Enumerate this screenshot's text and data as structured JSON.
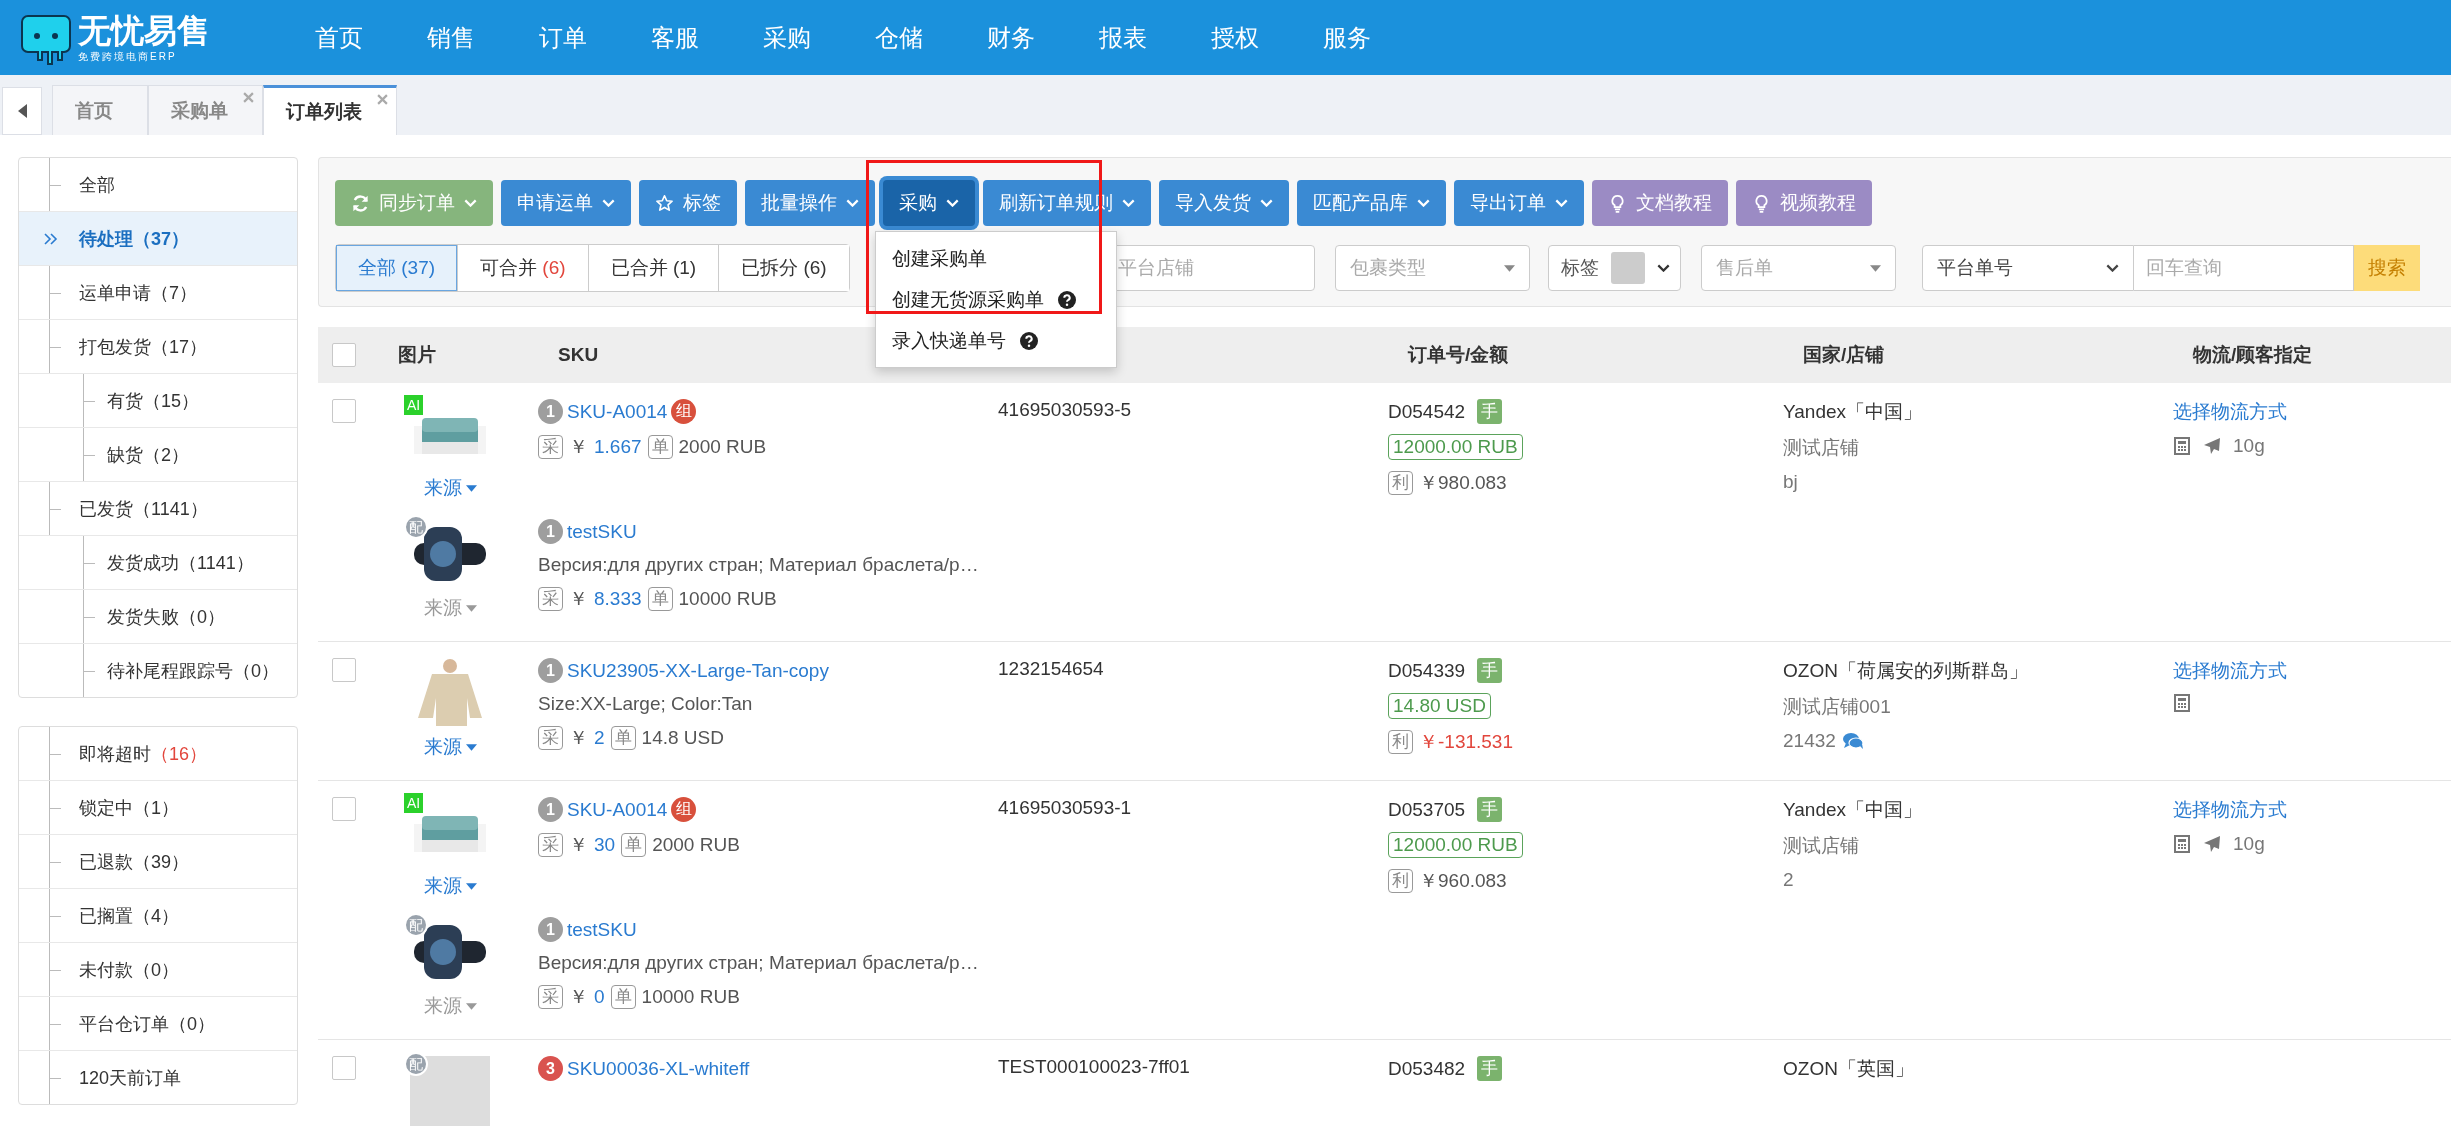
{
  "logo": {
    "title": "无忧易售",
    "subtitle": "免费跨境电商ERP"
  },
  "nav": [
    "首页",
    "销售",
    "订单",
    "客服",
    "采购",
    "仓储",
    "财务",
    "报表",
    "授权",
    "服务"
  ],
  "tabs": [
    {
      "label": "首页",
      "selected": false,
      "closable": false
    },
    {
      "label": "采购单",
      "selected": false,
      "closable": true
    },
    {
      "label": "订单列表",
      "selected": true,
      "closable": true
    }
  ],
  "sidebar": {
    "groups": [
      {
        "items": [
          {
            "label": "全部",
            "selected": false
          },
          {
            "label": "待处理",
            "count": "（37）",
            "alert": false,
            "selected": true
          },
          {
            "label": "运单申请",
            "count": "（7）",
            "alert": false,
            "selected": false
          },
          {
            "label": "打包发货",
            "count": "（17）",
            "alert": false,
            "selected": false,
            "children": [
              {
                "label": "有货",
                "count": "（15）",
                "alert": false,
                "selected": false
              },
              {
                "label": "缺货",
                "count": "（2）",
                "alert": false,
                "selected": false
              }
            ]
          },
          {
            "label": "已发货",
            "count": "（1141）",
            "alert": false,
            "selected": false,
            "children": [
              {
                "label": "发货成功",
                "count": "（1141）",
                "alert": false,
                "selected": false
              },
              {
                "label": "发货失败",
                "count": "（0）",
                "alert": false,
                "selected": false
              },
              {
                "label": "待补尾程跟踪号",
                "count": "（0）",
                "alert": false,
                "selected": false
              }
            ]
          }
        ]
      },
      {
        "items": [
          {
            "label": "即将超时",
            "count": "（16）",
            "alert": true,
            "selected": false
          },
          {
            "label": "锁定中",
            "count": "（1）",
            "alert": false,
            "selected": false
          },
          {
            "label": "已退款",
            "count": "（39）",
            "alert": false,
            "selected": false
          },
          {
            "label": "已搁置",
            "count": "（4）",
            "alert": false,
            "selected": false
          },
          {
            "label": "未付款",
            "count": "（0）",
            "alert": false,
            "selected": false
          },
          {
            "label": "平台仓订单",
            "count": "（0）",
            "alert": false,
            "selected": false
          },
          {
            "label": "120天前订单",
            "selected": false
          }
        ]
      }
    ]
  },
  "toolbar": {
    "buttons": [
      {
        "label": "同步订单",
        "kind": "sync",
        "expanded": false
      },
      {
        "label": "申请运单",
        "kind": "dropdown",
        "expanded": false
      },
      {
        "label": "标签",
        "kind": "tag",
        "expanded": false
      },
      {
        "label": "批量操作",
        "kind": "dropdown",
        "expanded": false
      },
      {
        "label": "采购",
        "kind": "dropdown",
        "expanded": true,
        "menu": [
          {
            "label": "创建采购单",
            "help": false
          },
          {
            "label": "创建无货源采购单",
            "help": true
          },
          {
            "label": "录入快递单号",
            "help": true
          }
        ]
      },
      {
        "label": "刷新订单规则",
        "kind": "dropdown",
        "expanded": false
      },
      {
        "label": "导入发货",
        "kind": "dropdown",
        "expanded": false
      },
      {
        "label": "匹配产品库",
        "kind": "dropdown",
        "expanded": false
      },
      {
        "label": "导出订单",
        "kind": "dropdown",
        "expanded": false
      },
      {
        "label": "文档教程",
        "kind": "tutorial",
        "expanded": false
      },
      {
        "label": "视频教程",
        "kind": "tutorial",
        "expanded": false
      }
    ]
  },
  "filters": {
    "segments": [
      {
        "label": "全部",
        "count": "(37)",
        "alert": false,
        "selected": true
      },
      {
        "label": "可合并",
        "count": "(6)",
        "alert": true,
        "selected": false
      },
      {
        "label": "已合并",
        "count": "(1)",
        "alert": false,
        "selected": false
      },
      {
        "label": "已拆分",
        "count": "(6)",
        "alert": false,
        "selected": false
      }
    ],
    "store": {
      "placeholder": "平台店铺"
    },
    "package_type": {
      "placeholder": "包裹类型"
    },
    "tag": {
      "label": "标签"
    },
    "after_sale": {
      "placeholder": "售后单"
    },
    "search_by": {
      "value": "平台单号"
    },
    "search": {
      "placeholder": "回车查询"
    },
    "search_button": "搜索"
  },
  "table": {
    "select_all_checked": false,
    "columns": [
      {
        "label": "图片"
      },
      {
        "label": "SKU"
      },
      {
        "label": "订单号/金额"
      },
      {
        "label": "国家/店铺"
      },
      {
        "label": "物流/顾客指定"
      }
    ],
    "rows": [
      {
        "checked": false,
        "platform_order": "41695030593-5",
        "order_no": "D054542",
        "mark": "手",
        "amount": "12000.00 RUB",
        "profit_tag": "利",
        "profit": "￥980.083",
        "profit_loss": false,
        "platform": "Yandex「中国」",
        "store": "测试店铺",
        "note": "bj",
        "chat": false,
        "logistics": "选择物流方式",
        "plane": true,
        "weight": "10g",
        "products": [
          {
            "qty": "1",
            "color": "#9e9e9e",
            "sku": "SKU-A0014",
            "combo": "组",
            "image_tag": "AI",
            "kind": "sofa",
            "source": "来源",
            "source_linked": true,
            "cost_tag": "采",
            "currency": "￥",
            "cost": "1.667",
            "price_tag": "单",
            "price": "2000 RUB"
          },
          {
            "qty": "1",
            "color": "#9e9e9e",
            "sku": "testSKU",
            "attrs": "Версия:для других стран; Материал браслета/р…",
            "image_tag": "配",
            "kind": "watch",
            "source": "来源",
            "source_linked": false,
            "cost_tag": "采",
            "currency": "￥",
            "cost": "8.333",
            "price_tag": "单",
            "price": "10000 RUB"
          }
        ]
      },
      {
        "checked": false,
        "platform_order": "1232154654",
        "order_no": "D054339",
        "mark": "手",
        "amount": "14.80 USD",
        "profit_tag": "利",
        "profit": "￥-131.531",
        "profit_loss": true,
        "platform": "OZON「荷属安的列斯群岛」",
        "store": "测试店铺001",
        "note": "21432",
        "chat": true,
        "logistics": "选择物流方式",
        "plane": false,
        "products": [
          {
            "qty": "1",
            "color": "#9e9e9e",
            "sku": "SKU23905-XX-Large-Tan-copy",
            "attrs": "Size:XX-Large; Color:Tan",
            "kind": "sweater",
            "source": "来源",
            "source_linked": true,
            "cost_tag": "采",
            "currency": "￥",
            "cost": "2",
            "price_tag": "单",
            "price": "14.8 USD"
          }
        ]
      },
      {
        "checked": false,
        "platform_order": "41695030593-1",
        "order_no": "D053705",
        "mark": "手",
        "amount": "12000.00 RUB",
        "profit_tag": "利",
        "profit": "￥960.083",
        "profit_loss": false,
        "platform": "Yandex「中国」",
        "store": "测试店铺",
        "note": "2",
        "chat": false,
        "logistics": "选择物流方式",
        "plane": true,
        "weight": "10g",
        "products": [
          {
            "qty": "1",
            "color": "#9e9e9e",
            "sku": "SKU-A0014",
            "combo": "组",
            "image_tag": "AI",
            "kind": "sofa",
            "source": "来源",
            "source_linked": true,
            "cost_tag": "采",
            "currency": "￥",
            "cost": "30",
            "price_tag": "单",
            "price": "2000 RUB"
          },
          {
            "qty": "1",
            "color": "#9e9e9e",
            "sku": "testSKU",
            "attrs": "Версия:для других стран; Материал браслета/р…",
            "image_tag": "配",
            "kind": "watch",
            "source": "来源",
            "source_linked": false,
            "cost_tag": "采",
            "currency": "￥",
            "cost": "0",
            "price_tag": "单",
            "price": "10000 RUB"
          }
        ]
      },
      {
        "checked": false,
        "platform_order": "TEST000100023-7ff01",
        "order_no": "D053482",
        "mark": "手",
        "platform": "OZON「英国」",
        "products": [
          {
            "qty": "3",
            "color": "#d9534f",
            "sku": "SKU00036-XL-whiteff",
            "image_tag": "配",
            "kind": "blank"
          }
        ]
      }
    ]
  }
}
